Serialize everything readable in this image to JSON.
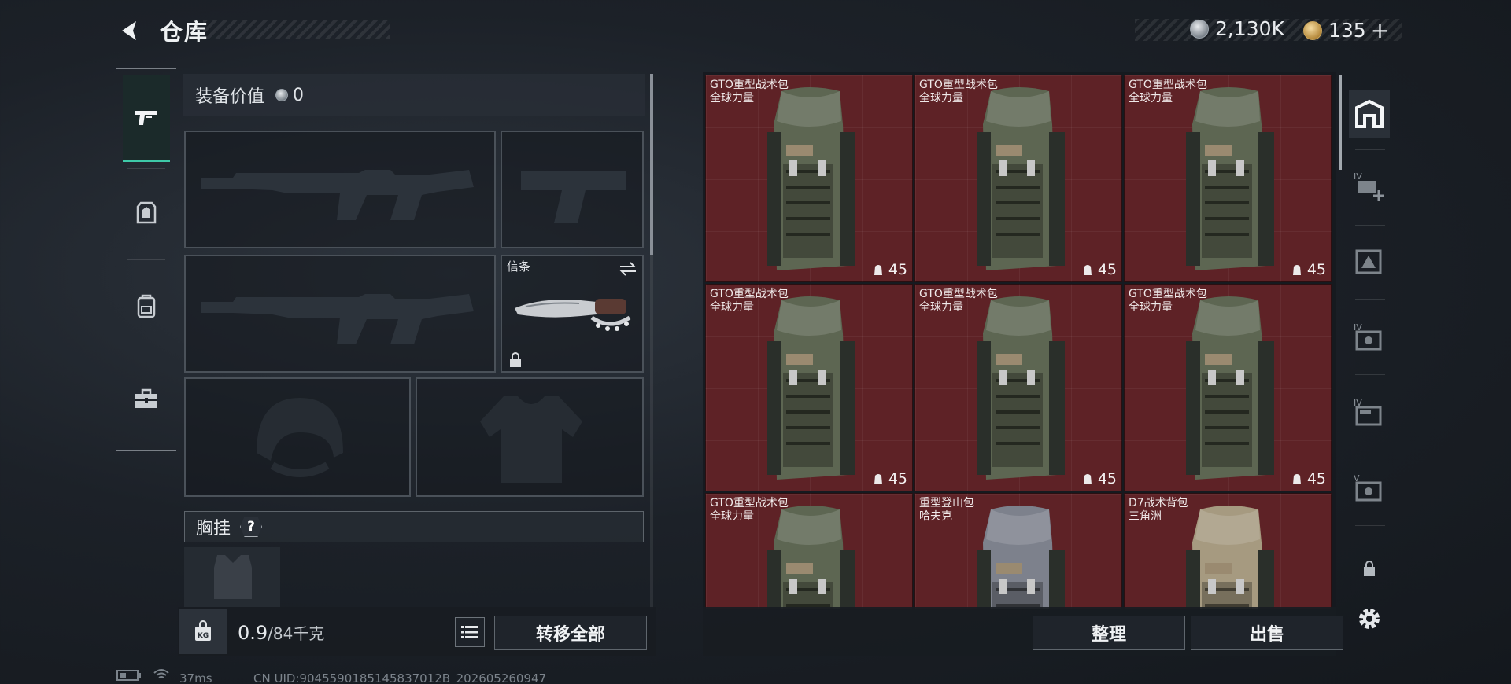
{
  "header": {
    "title": "仓库",
    "currency_primary": "2,130K",
    "currency_secondary": "135",
    "plus": "+"
  },
  "rail": {
    "items": [
      {
        "name": "weapons",
        "icon": "pistol-icon",
        "active": true
      },
      {
        "name": "armor",
        "icon": "armor-icon",
        "active": false
      },
      {
        "name": "backpack",
        "icon": "backpack-icon",
        "active": false
      },
      {
        "name": "case",
        "icon": "briefcase-icon",
        "active": false
      }
    ]
  },
  "equip": {
    "value_label": "装备价值",
    "value": "0",
    "melee_label": "信条",
    "chest_label": "胸挂",
    "help": "?",
    "weight_current": "0.9",
    "weight_max": "/84千克",
    "transfer_all": "转移全部"
  },
  "stash": {
    "items": [
      {
        "name": "GTO重型战术包",
        "brand": "全球力量",
        "qty": "45",
        "color": "#5d6652"
      },
      {
        "name": "GTO重型战术包",
        "brand": "全球力量",
        "qty": "45",
        "color": "#5d6652"
      },
      {
        "name": "GTO重型战术包",
        "brand": "全球力量",
        "qty": "45",
        "color": "#5d6652"
      },
      {
        "name": "GTO重型战术包",
        "brand": "全球力量",
        "qty": "45",
        "color": "#5d6652"
      },
      {
        "name": "GTO重型战术包",
        "brand": "全球力量",
        "qty": "45",
        "color": "#5d6652"
      },
      {
        "name": "GTO重型战术包",
        "brand": "全球力量",
        "qty": "45",
        "color": "#5d6652"
      },
      {
        "name": "GTO重型战术包",
        "brand": "全球力量",
        "qty": "",
        "color": "#5d6652"
      },
      {
        "name": "重型登山包",
        "brand": "哈夫克",
        "qty": "",
        "color": "#7d818c"
      },
      {
        "name": "D7战术背包",
        "brand": "三角洲",
        "qty": "",
        "color": "#a69a80"
      }
    ],
    "sort": "整理",
    "sell": "出售"
  },
  "tools": [
    {
      "icon": "stash-icon",
      "active": true
    },
    {
      "icon": "expand-add-icon",
      "label": "IV"
    },
    {
      "icon": "warning-box-icon",
      "label": ""
    },
    {
      "icon": "camera-box-icon",
      "label": "IV"
    },
    {
      "icon": "folder-box-icon",
      "label": "IV"
    },
    {
      "icon": "camera-box-icon",
      "label": "V"
    },
    {
      "icon": "lock-icon",
      "label": ""
    },
    {
      "icon": "settings-icon",
      "label": ""
    }
  ],
  "status": {
    "ping": "37ms",
    "uid": "CN UID:9045590185145837012B_202605260947"
  },
  "colors": {
    "accent": "#3ec9a8",
    "cell_bg": "#5e2226"
  }
}
